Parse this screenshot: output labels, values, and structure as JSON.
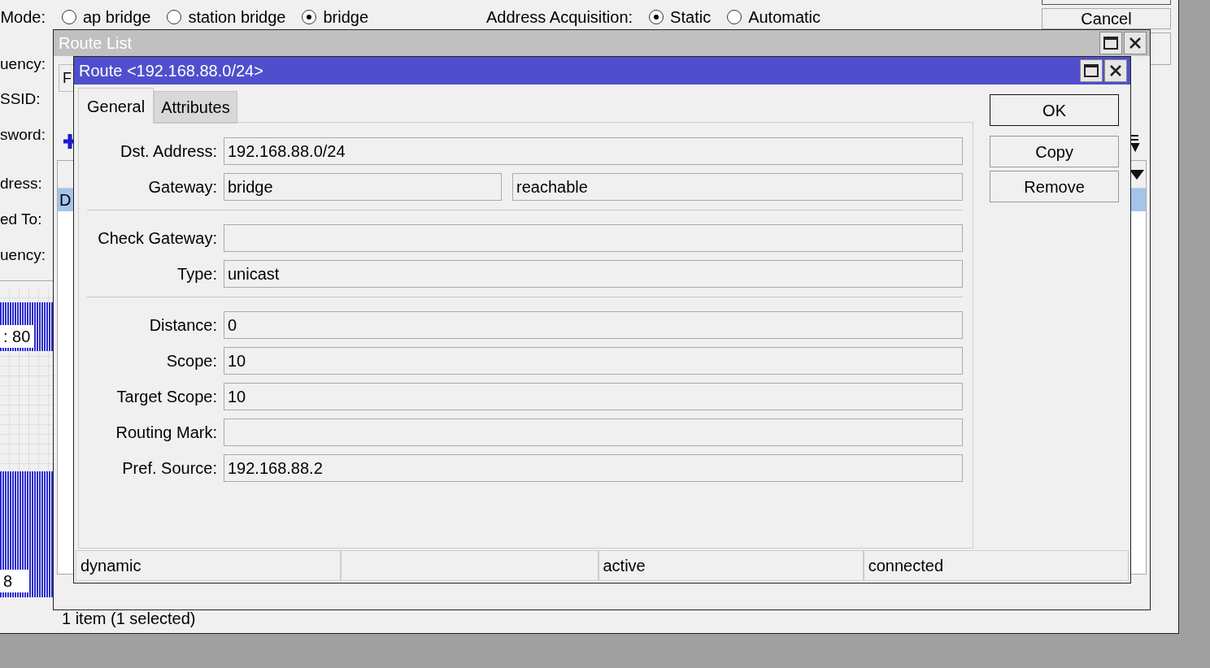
{
  "background_window": {
    "mode_label": "Mode:",
    "mode_options": [
      {
        "label": "ap bridge",
        "selected": false
      },
      {
        "label": "station bridge",
        "selected": false
      },
      {
        "label": "bridge",
        "selected": true
      }
    ],
    "address_acquisition_label": "Address Acquisition:",
    "address_options": [
      {
        "label": "Static",
        "selected": true
      },
      {
        "label": "Automatic",
        "selected": false
      }
    ],
    "labels": [
      "uency:",
      "SSID:",
      "sword:",
      "dress:",
      "ed To:",
      "uency:"
    ],
    "buttons": [
      "Cancel"
    ],
    "graph_labels": [
      ": 80",
      "8"
    ]
  },
  "route_list": {
    "title": "Route List",
    "tab": "F",
    "selected_row_cell": "D",
    "status": "1 item (1 selected)"
  },
  "route_dialog": {
    "title": "Route <192.168.88.0/24>",
    "tabs": [
      {
        "label": "General",
        "selected": true
      },
      {
        "label": "Attributes",
        "selected": false
      }
    ],
    "groups": [
      [
        {
          "kind": "single",
          "label": "Dst. Address:",
          "value": "192.168.88.0/24"
        },
        {
          "kind": "pair",
          "label": "Gateway:",
          "values": [
            "bridge",
            "reachable"
          ]
        }
      ],
      [
        {
          "kind": "single",
          "label": "Check Gateway:"
        },
        {
          "kind": "single",
          "label": "Type:",
          "value": "unicast"
        }
      ],
      [
        {
          "kind": "single",
          "label": "Distance:",
          "value": "0"
        },
        {
          "kind": "single",
          "label": "Scope:",
          "value": "10"
        },
        {
          "kind": "single",
          "label": "Target Scope:",
          "value": "10"
        },
        {
          "kind": "single",
          "label": "Routing Mark:"
        },
        {
          "kind": "single",
          "label": "Pref. Source:",
          "value": "192.168.88.2"
        }
      ]
    ],
    "buttons": [
      {
        "label": "OK",
        "default": true
      },
      {
        "label": "Copy",
        "default": false
      },
      {
        "label": "Remove",
        "default": false
      }
    ],
    "status_bar": [
      {
        "kind": "text",
        "text": "dynamic"
      },
      {
        "kind": "blank"
      },
      {
        "kind": "text",
        "text": "active"
      },
      {
        "kind": "text",
        "text": "connected"
      }
    ]
  }
}
